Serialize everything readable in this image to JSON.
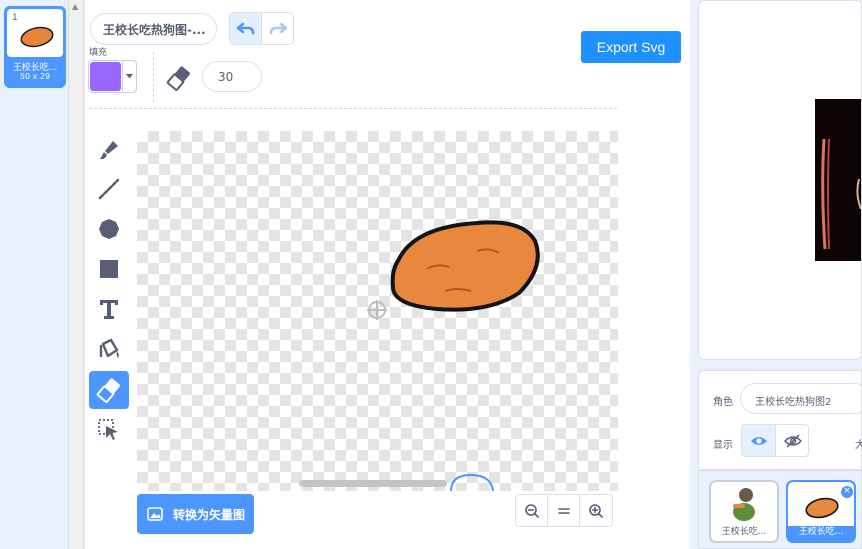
{
  "costume_list": {
    "items": [
      {
        "number": "1",
        "name": "王校长吃...",
        "size": "50 x 29"
      }
    ]
  },
  "editor": {
    "costume_name": "王校长吃热狗图-...",
    "export_label": "Export Svg",
    "fill_label": "填充",
    "fill_color": "#9966ff",
    "eraser_size": "30",
    "tools": [
      "brush-icon",
      "line-icon",
      "circle-icon",
      "rectangle-icon",
      "text-icon",
      "fill-bucket-icon",
      "eraser-icon",
      "select-icon"
    ],
    "active_tool": "eraser-icon",
    "convert_label": "转换为矢量图",
    "zoom_buttons": [
      "zoom-out-icon",
      "zoom-reset-icon",
      "zoom-in-icon"
    ]
  },
  "sprite_panel": {
    "sprite_label": "角色",
    "sprite_name": "王校长吃热狗图2",
    "show_label": "显示",
    "size_label_partial": "大",
    "sprites": [
      {
        "name": "王校长吃...",
        "selected": false
      },
      {
        "name": "王校长吃...",
        "selected": true
      }
    ]
  },
  "colors": {
    "accent": "#4c97ff",
    "export_button": "#1e90ff",
    "fill": "#9966ff"
  }
}
